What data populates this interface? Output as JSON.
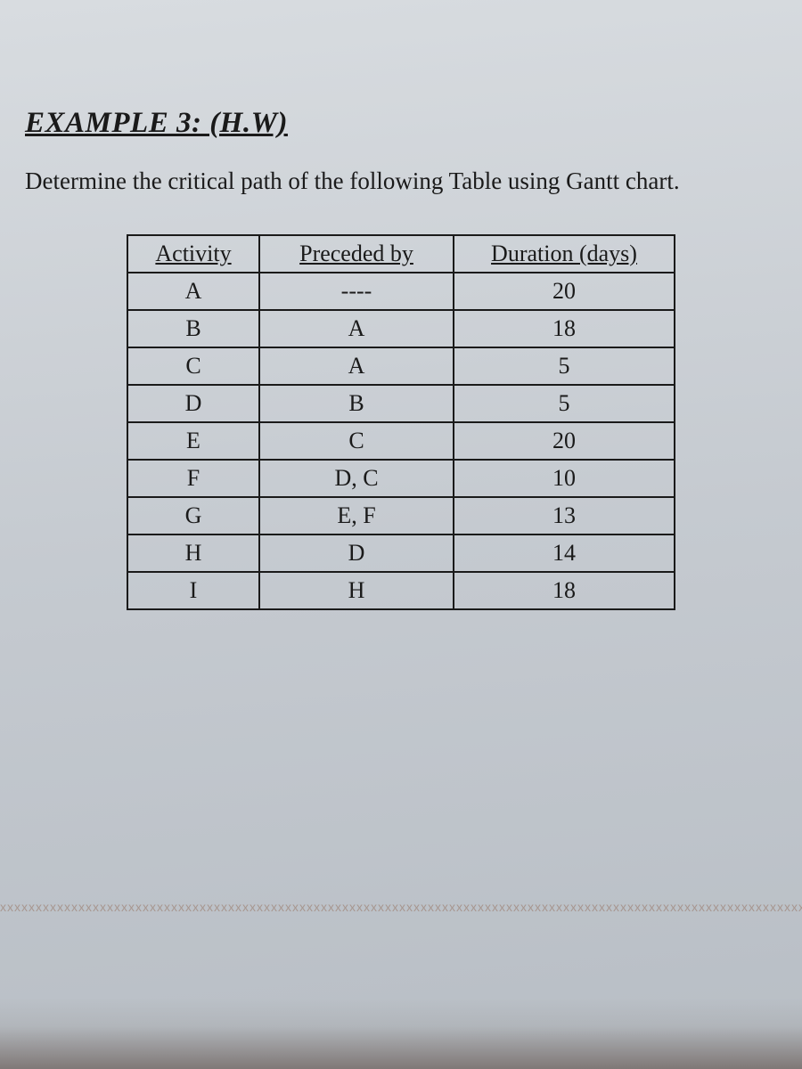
{
  "title": "EXAMPLE 3: (H.W)",
  "instruction": "Determine the critical path of the following Table using Gantt chart.",
  "table": {
    "headers": {
      "activity": "Activity",
      "preceded_by": "Preceded by",
      "duration": "Duration (days)"
    },
    "rows": [
      {
        "activity": "A",
        "preceded_by": "----",
        "duration": "20"
      },
      {
        "activity": "B",
        "preceded_by": "A",
        "duration": "18"
      },
      {
        "activity": "C",
        "preceded_by": "A",
        "duration": "5"
      },
      {
        "activity": "D",
        "preceded_by": "B",
        "duration": "5"
      },
      {
        "activity": "E",
        "preceded_by": "C",
        "duration": "20"
      },
      {
        "activity": "F",
        "preceded_by": "D, C",
        "duration": "10"
      },
      {
        "activity": "G",
        "preceded_by": "E, F",
        "duration": "13"
      },
      {
        "activity": "H",
        "preceded_by": "D",
        "duration": "14"
      },
      {
        "activity": "I",
        "preceded_by": "H",
        "duration": "18"
      }
    ]
  },
  "chart_data": {
    "type": "table",
    "title": "Activity precedence and duration",
    "columns": [
      "Activity",
      "Preceded by",
      "Duration (days)"
    ],
    "rows": [
      [
        "A",
        "----",
        20
      ],
      [
        "B",
        "A",
        18
      ],
      [
        "C",
        "A",
        5
      ],
      [
        "D",
        "B",
        5
      ],
      [
        "E",
        "C",
        20
      ],
      [
        "F",
        "D, C",
        10
      ],
      [
        "G",
        "E, F",
        13
      ],
      [
        "H",
        "D",
        14
      ],
      [
        "I",
        "H",
        18
      ]
    ]
  }
}
